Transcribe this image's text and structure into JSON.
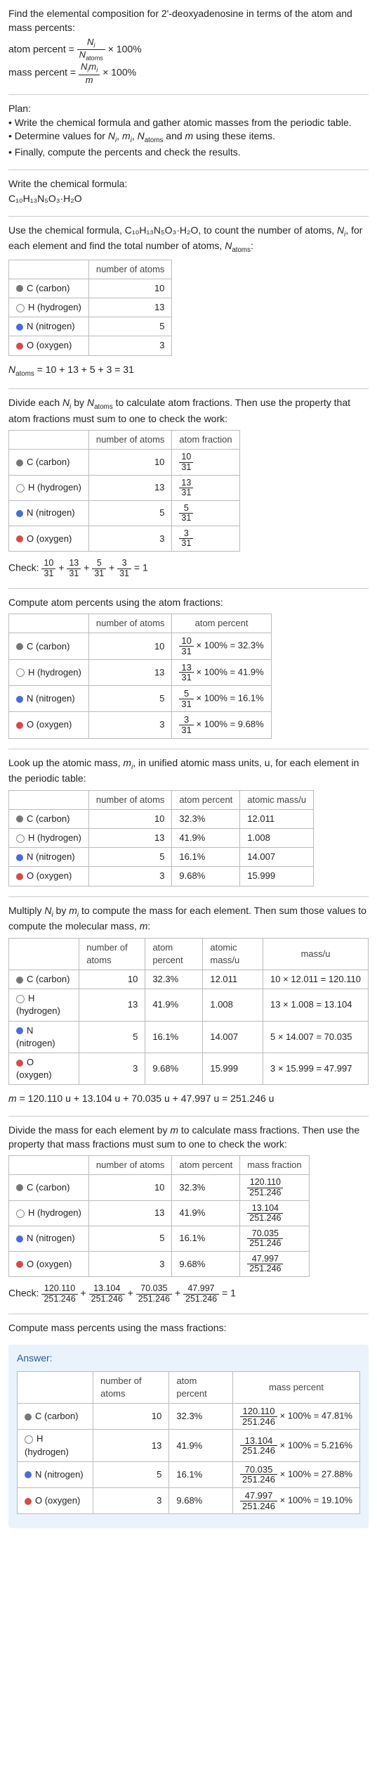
{
  "intro": {
    "line1": "Find the elemental composition for 2'-deoxyadenosine in terms of the atom and mass percents:",
    "atom_percent_label": "atom percent =",
    "atom_percent_rhs": "× 100%",
    "mass_percent_label": "mass percent =",
    "mass_percent_rhs": "× 100%",
    "ni": "N",
    "ni_sub": "i",
    "natoms": "N",
    "natoms_sub": "atoms",
    "nimi": "N",
    "mi_sub": "i",
    "m_lbl": "m"
  },
  "plan": {
    "title": "Plan:",
    "b1": "• Write the chemical formula and gather atomic masses from the periodic table.",
    "b2_a": "• Determine values for ",
    "b2_b": " using these items.",
    "b3": "• Finally, compute the percents and check the results.",
    "list_items": "N_i, m_i, N_atoms and m"
  },
  "formula": {
    "lead": "Write the chemical formula:",
    "text": "C₁₀H₁₃N₅O₃·H₂O"
  },
  "count": {
    "lead_a": "Use the chemical formula, C₁₀H₁₃N₅O₃·H₂O, to count the number of atoms, ",
    "lead_b": ", for each element and find the total number of atoms, ",
    "lead_c": ":",
    "col1": "",
    "col2": "number of atoms",
    "elements": {
      "c": "C (carbon)",
      "h": "H (hydrogen)",
      "n": "N (nitrogen)",
      "o": "O (oxygen)"
    },
    "vals": {
      "c": "10",
      "h": "13",
      "n": "5",
      "o": "3"
    },
    "sum": "N_atoms = 10 + 13 + 5 + 3 = 31"
  },
  "atomfrac": {
    "lead": "Divide each N_i by N_atoms to calculate atom fractions. Then use the property that atom fractions must sum to one to check the work:",
    "col2": "number of atoms",
    "col3": "atom fraction",
    "fracs": {
      "c": {
        "num": "10",
        "den": "31"
      },
      "h": {
        "num": "13",
        "den": "31"
      },
      "n": {
        "num": "5",
        "den": "31"
      },
      "o": {
        "num": "3",
        "den": "31"
      }
    },
    "check": "Check: "
  },
  "atompct": {
    "lead": "Compute atom percents using the atom fractions:",
    "col2": "number of atoms",
    "col3": "atom percent",
    "pcts": {
      "c": {
        "num": "10",
        "den": "31",
        "res": "= 32.3%"
      },
      "h": {
        "num": "13",
        "den": "31",
        "res": "= 41.9%"
      },
      "n": {
        "num": "5",
        "den": "31",
        "res": "= 16.1%"
      },
      "o": {
        "num": "3",
        "den": "31",
        "res": "= 9.68%"
      }
    },
    "times": "× 100% "
  },
  "masses": {
    "lead": "Look up the atomic mass, m_i, in unified atomic mass units, u, for each element in the periodic table:",
    "col2": "number of atoms",
    "col3": "atom percent",
    "col4": "atomic mass/u",
    "rows": {
      "c": {
        "n": "10",
        "p": "32.3%",
        "m": "12.011"
      },
      "h": {
        "n": "13",
        "p": "41.9%",
        "m": "1.008"
      },
      "n": {
        "n": "5",
        "p": "16.1%",
        "m": "14.007"
      },
      "o": {
        "n": "3",
        "p": "9.68%",
        "m": "15.999"
      }
    }
  },
  "molmass": {
    "lead": "Multiply N_i by m_i to compute the mass for each element. Then sum those values to compute the molecular mass, m:",
    "col2": "number of atoms",
    "col3": "atom percent",
    "col4": "atomic mass/u",
    "col5": "mass/u",
    "rows": {
      "c": {
        "n": "10",
        "p": "32.3%",
        "m": "12.011",
        "calc": "10 × 12.011 = 120.110"
      },
      "h": {
        "n": "13",
        "p": "41.9%",
        "m": "1.008",
        "calc": "13 × 1.008 = 13.104"
      },
      "n": {
        "n": "5",
        "p": "16.1%",
        "m": "14.007",
        "calc": "5 × 14.007 = 70.035"
      },
      "o": {
        "n": "3",
        "p": "9.68%",
        "m": "15.999",
        "calc": "3 × 15.999 = 47.997"
      }
    },
    "sum": "m = 120.110 u + 13.104 u + 70.035 u + 47.997 u = 251.246 u"
  },
  "massfrac": {
    "lead": "Divide the mass for each element by m to calculate mass fractions. Then use the property that mass fractions must sum to one to check the work:",
    "col2": "number of atoms",
    "col3": "atom percent",
    "col4": "mass fraction",
    "rows": {
      "c": {
        "n": "10",
        "p": "32.3%",
        "num": "120.110",
        "den": "251.246"
      },
      "h": {
        "n": "13",
        "p": "41.9%",
        "num": "13.104",
        "den": "251.246"
      },
      "n": {
        "n": "5",
        "p": "16.1%",
        "num": "70.035",
        "den": "251.246"
      },
      "o": {
        "n": "3",
        "p": "9.68%",
        "num": "47.997",
        "den": "251.246"
      }
    },
    "check": "Check: ",
    "eq": " = 1"
  },
  "masspct": {
    "lead": "Compute mass percents using the mass fractions:"
  },
  "answer": {
    "title": "Answer:",
    "col2": "number of atoms",
    "col3": "atom percent",
    "col4": "mass percent",
    "rows": {
      "c": {
        "n": "10",
        "p": "32.3%",
        "num": "120.110",
        "den": "251.246",
        "res": "× 100% = 47.81%"
      },
      "h": {
        "n": "13",
        "p": "41.9%",
        "num": "13.104",
        "den": "251.246",
        "res": "× 100% = 5.216%"
      },
      "n": {
        "n": "5",
        "p": "16.1%",
        "num": "70.035",
        "den": "251.246",
        "res": "× 100% = 27.88%"
      },
      "o": {
        "n": "3",
        "p": "9.68%",
        "num": "47.997",
        "den": "251.246",
        "res": "× 100% = 19.10%"
      }
    }
  },
  "chart_data": {
    "type": "table",
    "title": "Elemental composition of 2'-deoxyadenosine (C10H13N5O3·H2O)",
    "total_atoms": 31,
    "molecular_mass_u": 251.246,
    "elements": [
      {
        "element": "C",
        "atoms": 10,
        "atom_fraction": 0.3226,
        "atom_percent": 32.3,
        "atomic_mass_u": 12.011,
        "mass_u": 120.11,
        "mass_fraction": 0.4781,
        "mass_percent": 47.81
      },
      {
        "element": "H",
        "atoms": 13,
        "atom_fraction": 0.4194,
        "atom_percent": 41.9,
        "atomic_mass_u": 1.008,
        "mass_u": 13.104,
        "mass_fraction": 0.05216,
        "mass_percent": 5.216
      },
      {
        "element": "N",
        "atoms": 5,
        "atom_fraction": 0.1613,
        "atom_percent": 16.1,
        "atomic_mass_u": 14.007,
        "mass_u": 70.035,
        "mass_fraction": 0.2788,
        "mass_percent": 27.88
      },
      {
        "element": "O",
        "atoms": 3,
        "atom_fraction": 0.0968,
        "atom_percent": 9.68,
        "atomic_mass_u": 15.999,
        "mass_u": 47.997,
        "mass_fraction": 0.191,
        "mass_percent": 19.1
      }
    ]
  }
}
